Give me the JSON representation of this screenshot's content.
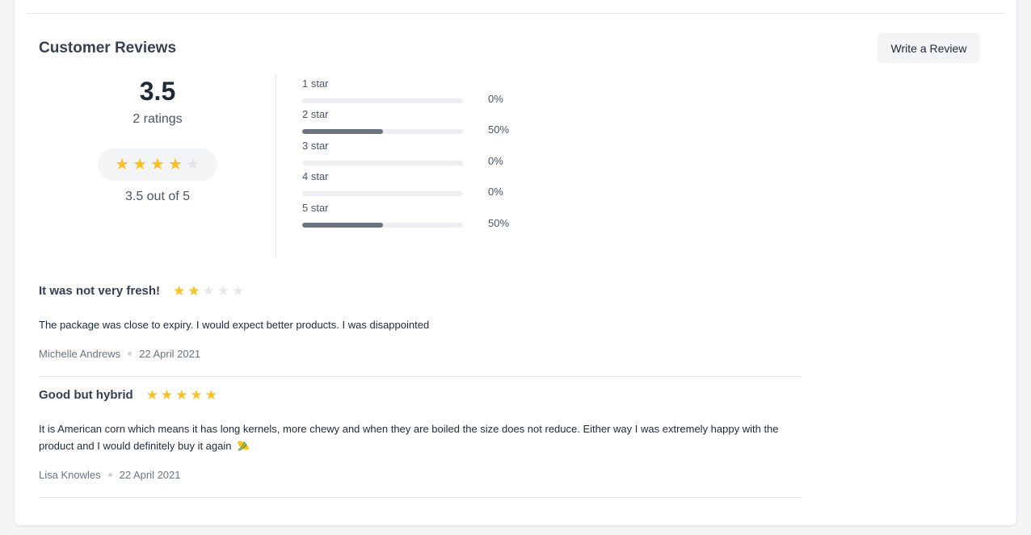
{
  "reviews_section": {
    "title": "Customer Reviews",
    "write_button_label": "Write a Review"
  },
  "summary": {
    "average": "3.5",
    "ratings_count_text": "2 ratings",
    "out_of_text": "3.5 out of 5",
    "stars_filled": 4,
    "stars_total": 5
  },
  "distribution": [
    {
      "label": "1 star",
      "percent_text": "0%",
      "percent": 0
    },
    {
      "label": "2 star",
      "percent_text": "50%",
      "percent": 50
    },
    {
      "label": "3 star",
      "percent_text": "0%",
      "percent": 0
    },
    {
      "label": "4 star",
      "percent_text": "0%",
      "percent": 0
    },
    {
      "label": "5 star",
      "percent_text": "50%",
      "percent": 50
    }
  ],
  "reviews": [
    {
      "title": "It was not very fresh!",
      "rating": 2,
      "body": "The package was close to expiry. I would expect better products. I was disappointed",
      "author": "Michelle Andrews",
      "date": "22 April 2021",
      "has_emoji": false
    },
    {
      "title": "Good but hybrid",
      "rating": 5,
      "body": "It is American corn which means it has long kernels, more chewy and when they are boiled the size does not reduce. Either way I was extremely happy with the product and I would definitely buy it again",
      "author": "Lisa Knowles",
      "date": "22 April 2021",
      "has_emoji": true,
      "emoji_icon": "corn-icon"
    }
  ],
  "colors": {
    "star_on": "#fbbf24",
    "star_off": "#e5e7eb",
    "bar_fill": "#6b7280",
    "bar_track": "#eceef1"
  }
}
